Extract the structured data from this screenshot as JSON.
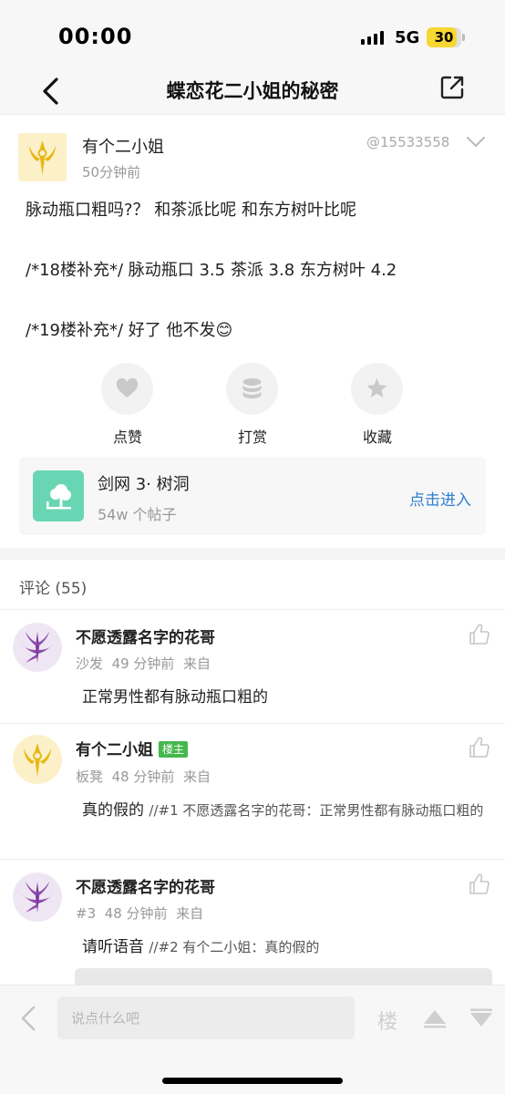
{
  "status_bar": {
    "time": "00:00",
    "network": "5G",
    "battery": "30",
    "battery_level": 0.3
  },
  "nav": {
    "title": "蝶恋花二小姐的秘密",
    "back_icon": "back-chevron-icon",
    "share_icon": "share-external-icon"
  },
  "post": {
    "author": "有个二小姐",
    "time": "50分钟前",
    "id": "@15533558",
    "lines": [
      "脉动瓶口粗吗?？ 和茶派比呢 和东方树叶比呢",
      "/*18楼补充*/ 脉动瓶口 3.5  茶派 3.8 东方树叶 4.2",
      "/*19楼补充*/ 好了 他不发😊"
    ]
  },
  "actions": [
    {
      "label": "点赞",
      "icon": "heart-icon"
    },
    {
      "label": "打赏",
      "icon": "coins-icon"
    },
    {
      "label": "收藏",
      "icon": "star-icon"
    }
  ],
  "forum": {
    "name": "剑网 3· 树洞",
    "count": "54w 个帖子",
    "enter": "点击进入"
  },
  "comments_title": "评论 (55)",
  "comments": [
    {
      "name": "不愿透露名字的花哥",
      "floor": "沙发",
      "time": "49 分钟前",
      "source": "来自",
      "text": "正常男性都有脉动瓶口粗的",
      "quote": ""
    },
    {
      "name": "有个二小姐",
      "badge": "楼主",
      "floor": "板凳",
      "time": "48 分钟前",
      "source": "来自",
      "text": "真的假的",
      "quote": "//#1 不愿透露名字的花哥：正常男性都有脉动瓶口粗的"
    },
    {
      "name": "不愿透露名字的花哥",
      "floor": "#3",
      "time": "48 分钟前",
      "source": "来自",
      "text": "请听语音",
      "quote": "//#2 有个二小姐：真的假的"
    }
  ],
  "bottom_bar": {
    "placeholder": "说点什么吧",
    "floor_label": "楼"
  },
  "colors": {
    "accent_link": "#2e7fd1",
    "forum_icon_bg": "#69d6b3",
    "op_badge": "#43b84c",
    "battery": "#f7d731"
  }
}
